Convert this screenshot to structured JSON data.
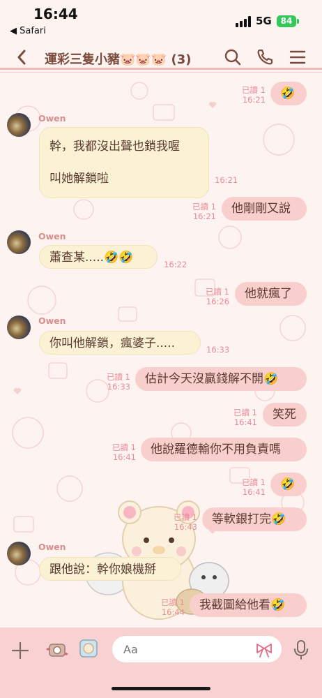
{
  "status": {
    "time": "16:44",
    "back_app": "◀ Safari",
    "network": "5G",
    "battery": "84"
  },
  "header": {
    "title": "運彩三隻小豬🐷🐷🐷 (3)",
    "icons": [
      "back-chevron-icon",
      "search-icon",
      "phone-icon",
      "menu-icon"
    ]
  },
  "messages": [
    {
      "dir": "out",
      "text": "🤣",
      "read": "已讀 1",
      "time": "16:21"
    },
    {
      "dir": "in",
      "sender": "Owen",
      "lines": [
        "幹，我都沒出聲也鎖我喔",
        "叫她解鎖啦"
      ],
      "time": "16:21"
    },
    {
      "dir": "out",
      "text": "他剛剛又說",
      "read": "已讀 1",
      "time": "16:21"
    },
    {
      "dir": "in",
      "sender": "Owen",
      "text": "蕭查某.....🤣🤣",
      "time": "16:22"
    },
    {
      "dir": "out",
      "text": "他就瘋了",
      "read": "已讀 1",
      "time": "16:26"
    },
    {
      "dir": "in",
      "sender": "Owen",
      "text": "你叫他解鎖，瘋婆子.....",
      "time": "16:33"
    },
    {
      "dir": "out",
      "text": "估計今天沒贏錢解不開🤣",
      "read": "已讀 1",
      "time": "16:33"
    },
    {
      "dir": "out",
      "text": "笑死",
      "read": "已讀 1",
      "time": "16:41"
    },
    {
      "dir": "out",
      "text": "他說羅德輸你不用負責嗎",
      "read": "已讀 1",
      "time": "16:41"
    },
    {
      "dir": "out",
      "text": "🤣",
      "read": "已讀 1",
      "time": "16:41"
    },
    {
      "dir": "out",
      "text": "等軟銀打完🤣",
      "read": "已讀 1",
      "time": "16:43"
    },
    {
      "dir": "in",
      "sender": "Owen",
      "text": "跟他說：幹你娘機掰",
      "time": ""
    },
    {
      "dir": "out",
      "text": "我截圖給他看🤣",
      "read": "已讀 1",
      "time": "16:44"
    }
  ],
  "input": {
    "placeholder": "Aa",
    "icons": [
      "plus-icon",
      "camera-icon",
      "album-icon",
      "ribbon-icon",
      "microphone-icon"
    ]
  },
  "colors": {
    "outgoing_bubble": "#f9cfcd",
    "incoming_bubble": "#fbf2d6",
    "accent": "#e98b96",
    "input_bar": "#f8d2d2"
  }
}
